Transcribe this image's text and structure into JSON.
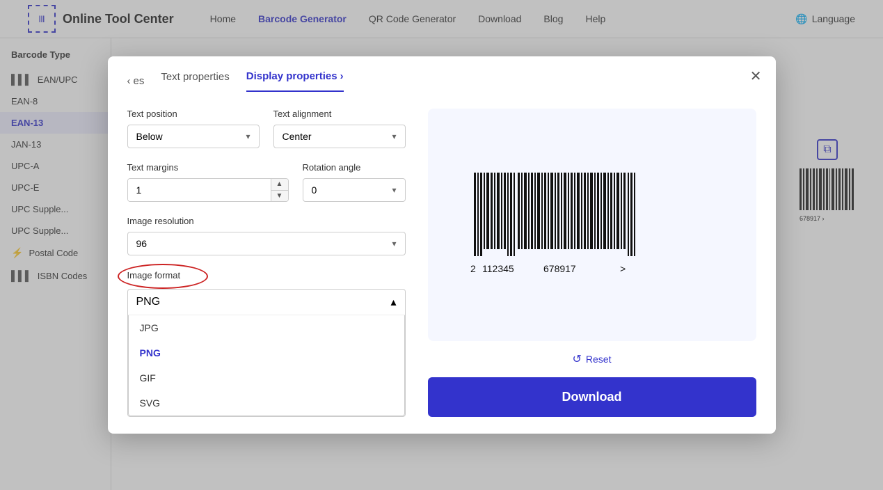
{
  "nav": {
    "logo_text": "Online Tool Center",
    "links": [
      "Home",
      "Barcode Generator",
      "QR Code Generator",
      "Download",
      "Blog",
      "Help"
    ],
    "active_link": "Barcode Generator",
    "language_label": "Language"
  },
  "sidebar": {
    "title": "Barcode Type",
    "items": [
      {
        "id": "ean-upc",
        "label": "EAN/UPC",
        "icon": "barcode"
      },
      {
        "id": "ean-8",
        "label": "EAN-8",
        "icon": ""
      },
      {
        "id": "ean-13",
        "label": "EAN-13",
        "icon": "",
        "active": true
      },
      {
        "id": "jan-13",
        "label": "JAN-13",
        "icon": ""
      },
      {
        "id": "upc-a",
        "label": "UPC-A",
        "icon": ""
      },
      {
        "id": "upc-e",
        "label": "UPC-E",
        "icon": ""
      },
      {
        "id": "upc-supplement",
        "label": "UPC Supple...",
        "icon": ""
      },
      {
        "id": "upc-supplement2",
        "label": "UPC Supple...",
        "icon": ""
      },
      {
        "id": "postal-code",
        "label": "Postal Code",
        "icon": "postal"
      },
      {
        "id": "isbn-codes",
        "label": "ISBN Codes",
        "icon": "barcode"
      }
    ]
  },
  "modal": {
    "tab_prev_label": "es",
    "tab_text_props": "Text properties",
    "tab_display_props": "Display properties",
    "tab_next_arrow": "›",
    "tab_prev_arrow": "‹",
    "close_symbol": "✕",
    "text_position_label": "Text position",
    "text_position_value": "Below",
    "text_alignment_label": "Text alignment",
    "text_alignment_value": "Center",
    "text_margins_label": "Text margins",
    "text_margins_value": "1",
    "rotation_angle_label": "Rotation angle",
    "rotation_angle_value": "0",
    "image_resolution_label": "Image resolution",
    "image_resolution_value": "96",
    "image_format_label": "Image format",
    "image_format_value": "PNG",
    "dropdown_options": [
      {
        "label": "JPG",
        "value": "jpg"
      },
      {
        "label": "PNG",
        "value": "png",
        "selected": true
      },
      {
        "label": "GIF",
        "value": "gif"
      },
      {
        "label": "SVG",
        "value": "svg"
      }
    ],
    "reset_label": "Reset",
    "download_label": "Download",
    "barcode_number": "2  112345  678917  >"
  }
}
